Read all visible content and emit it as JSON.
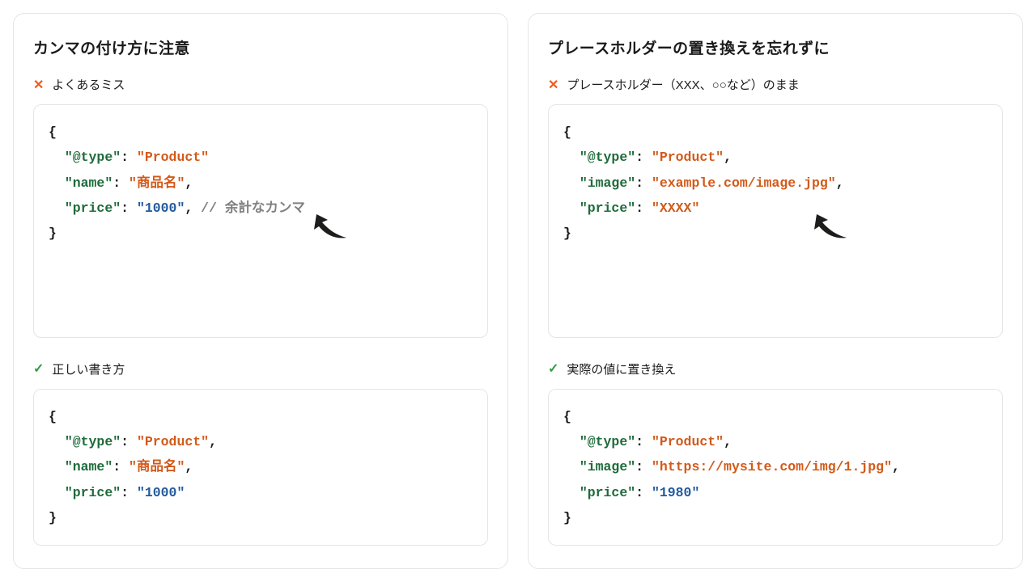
{
  "left": {
    "title": "カンマの付け方に注意",
    "bad_label": "よくあるミス",
    "good_label": "正しい書き方",
    "bad_code": {
      "lines": [
        {
          "indent": 0,
          "type": "brace",
          "text": "{"
        },
        {
          "indent": 1,
          "type": "kv",
          "key": "\"@type\"",
          "value": "\"Product\"",
          "value_kind": "str",
          "trailing": ""
        },
        {
          "indent": 1,
          "type": "kv",
          "key": "\"name\"",
          "value": "\"商品名\"",
          "value_kind": "str",
          "trailing": ","
        },
        {
          "indent": 1,
          "type": "kv",
          "key": "\"price\"",
          "value": "\"1000\"",
          "value_kind": "num",
          "trailing": ",",
          "comment": " // 余計なカンマ"
        },
        {
          "indent": 0,
          "type": "brace",
          "text": "}"
        }
      ]
    },
    "good_code": {
      "lines": [
        {
          "indent": 0,
          "type": "brace",
          "text": "{"
        },
        {
          "indent": 1,
          "type": "kv",
          "key": "\"@type\"",
          "value": "\"Product\"",
          "value_kind": "str",
          "trailing": ","
        },
        {
          "indent": 1,
          "type": "kv",
          "key": "\"name\"",
          "value": "\"商品名\"",
          "value_kind": "str",
          "trailing": ","
        },
        {
          "indent": 1,
          "type": "kv",
          "key": "\"price\"",
          "value": "\"1000\"",
          "value_kind": "num",
          "trailing": ""
        },
        {
          "indent": 0,
          "type": "brace",
          "text": "}"
        }
      ]
    }
  },
  "right": {
    "title": "プレースホルダーの置き換えを忘れずに",
    "bad_label": "プレースホルダー（XXX、○○など）のまま",
    "good_label": "実際の値に置き換え",
    "bad_code": {
      "lines": [
        {
          "indent": 0,
          "type": "brace",
          "text": "{"
        },
        {
          "indent": 1,
          "type": "kv",
          "key": "\"@type\"",
          "value": "\"Product\"",
          "value_kind": "str",
          "trailing": ","
        },
        {
          "indent": 1,
          "type": "kv",
          "key": "\"image\"",
          "value": "\"example.com/image.jpg\"",
          "value_kind": "str",
          "trailing": ","
        },
        {
          "indent": 1,
          "type": "kv",
          "key": "\"price\"",
          "value": "\"XXXX\"",
          "value_kind": "str",
          "trailing": ""
        },
        {
          "indent": 0,
          "type": "brace",
          "text": "}"
        }
      ]
    },
    "good_code": {
      "lines": [
        {
          "indent": 0,
          "type": "brace",
          "text": "{"
        },
        {
          "indent": 1,
          "type": "kv",
          "key": "\"@type\"",
          "value": "\"Product\"",
          "value_kind": "str",
          "trailing": ","
        },
        {
          "indent": 1,
          "type": "kv",
          "key": "\"image\"",
          "value": "\"https://mysite.com/img/1.jpg\"",
          "value_kind": "str",
          "trailing": ","
        },
        {
          "indent": 1,
          "type": "kv",
          "key": "\"price\"",
          "value": "\"1980\"",
          "value_kind": "num",
          "trailing": ""
        },
        {
          "indent": 0,
          "type": "brace",
          "text": "}"
        }
      ]
    }
  },
  "marks": {
    "bad": "✕",
    "good": "✓"
  }
}
